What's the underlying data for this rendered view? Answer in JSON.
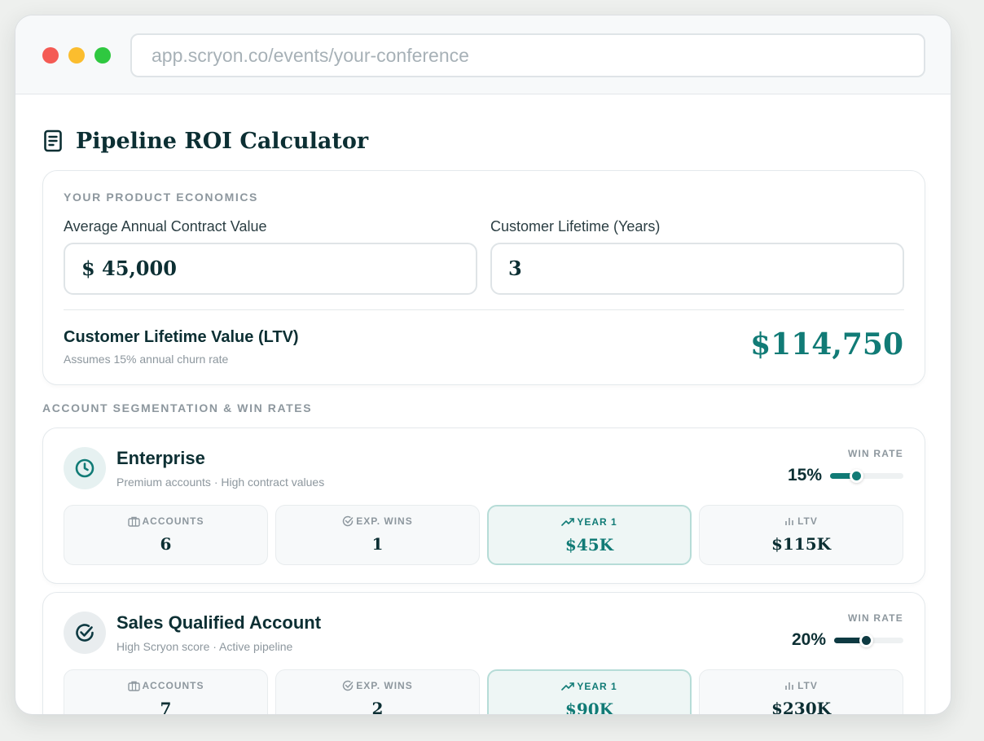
{
  "browser": {
    "url": "app.scryon.co/events/your-conference"
  },
  "page": {
    "title": "Pipeline ROI Calculator"
  },
  "economics": {
    "section_label": "YOUR PRODUCT ECONOMICS",
    "acv_label": "Average Annual Contract Value",
    "acv_value": "$ 45,000",
    "lifetime_label": "Customer Lifetime (Years)",
    "lifetime_value": "3",
    "ltv_title": "Customer Lifetime Value (LTV)",
    "ltv_subtitle": "Assumes 15% annual churn rate",
    "ltv_value": "$114,750"
  },
  "segmentation": {
    "section_label": "ACCOUNT SEGMENTATION & WIN RATES",
    "win_rate_label": "WIN RATE",
    "metric_labels": {
      "accounts": "ACCOUNTS",
      "exp_wins": "EXP. WINS",
      "year1": "YEAR 1",
      "ltv": "LTV"
    },
    "segments": [
      {
        "name": "Enterprise",
        "description": "Premium accounts · High contract values",
        "icon": "clock-icon",
        "win_rate": "15%",
        "win_rate_fraction": 0.36,
        "accent": "#117b76",
        "accounts": "6",
        "exp_wins": "1",
        "year1": "$45K",
        "ltv": "$115K"
      },
      {
        "name": "Sales Qualified Account",
        "description": "High Scryon score · Active pipeline",
        "icon": "check-circle-icon",
        "win_rate": "20%",
        "win_rate_fraction": 0.46,
        "accent": "#0e3a42",
        "accounts": "7",
        "exp_wins": "2",
        "year1": "$90K",
        "ltv": "$230K"
      }
    ]
  }
}
